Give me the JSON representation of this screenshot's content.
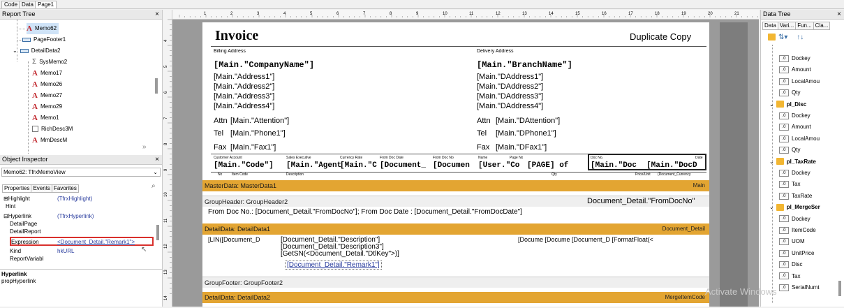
{
  "top_tabs": [
    "Code",
    "Data",
    "Page1"
  ],
  "report_tree": {
    "title": "Report Tree",
    "items": [
      "Memo62",
      "PageFooter1",
      "DetailData2",
      "SysMemo2",
      "Memo17",
      "Memo26",
      "Memo27",
      "Memo29",
      "Memo1",
      "RichDesc3M",
      "MmDescM"
    ]
  },
  "object_inspector": {
    "title": "Object Inspector",
    "selected": "Memo62: TfrxMemoView",
    "tabs": [
      "Properties",
      "Events",
      "Favorites"
    ],
    "props": [
      {
        "name": "Highlight",
        "value": "(TfrxHighlight)",
        "prefix": "⊞"
      },
      {
        "name": "Hint",
        "value": "",
        "prefix": ""
      },
      {
        "name": "Hyperlink",
        "value": "(TfrxHyperlink)",
        "prefix": "⊟"
      },
      {
        "name": "DetailPage",
        "value": "",
        "prefix": ""
      },
      {
        "name": "DetailReport",
        "value": "",
        "prefix": ""
      },
      {
        "name": "Expression",
        "value": "<Document_Detail.\"Remark1\">",
        "prefix": ""
      },
      {
        "name": "Kind",
        "value": "hkURL",
        "prefix": ""
      },
      {
        "name": "ReportVariabl",
        "value": "",
        "prefix": ""
      }
    ],
    "hint_title": "Hyperlink",
    "hint_text": "propHyperlink"
  },
  "ruler_numbers": [
    "1",
    "2",
    "3",
    "4",
    "5",
    "6",
    "7",
    "8",
    "9",
    "10",
    "11",
    "12",
    "13",
    "14",
    "15",
    "16",
    "17",
    "18",
    "19",
    "20",
    "21",
    "22"
  ],
  "ruler_v_numbers": [
    "4",
    "5",
    "6",
    "7",
    "8",
    "9",
    "10",
    "11",
    "12",
    "13",
    "14"
  ],
  "report": {
    "invoice_title": "Invoice",
    "duplicate": "Duplicate Copy",
    "billing_label": "Billing Address",
    "delivery_label": "Delivery Address",
    "company": "[Main.\"CompanyName\"]",
    "branch": "[Main.\"BranchName\"]",
    "addr": [
      "[Main.\"Address1\"]",
      "[Main.\"Address2\"]",
      "[Main.\"Address3\"]",
      "[Main.\"Address4\"]"
    ],
    "daddr": [
      "[Main.\"DAddress1\"]",
      "[Main.\"DAddress2\"]",
      "[Main.\"DAddress3\"]",
      "[Main.\"DAddress4\"]"
    ],
    "attn_l": "Attn",
    "attn_v": "[Main.\"Attention\"]",
    "tel_l": "Tel",
    "tel_v": "[Main.\"Phone1\"]",
    "fax_l": "Fax",
    "fax_v": "[Main.\"Fax1\"]",
    "dattn_v": "[Main.\"DAttention\"]",
    "dtel_v": "[Main.\"DPhone1\"]",
    "dfax_v": "[Main.\"DFax1\"]",
    "hdr_labels": [
      "Customer Account",
      "Sales Executive",
      "Currency Rate",
      "From Doc Date",
      "From Doc No",
      "Name",
      "Page No",
      "Doc No.",
      "Date"
    ],
    "hdr_values": [
      "[Main.\"Code\"]",
      "[Main.\"Agent",
      "[Main.\"C",
      "[Document_",
      "[Documen",
      "[User.\"Co",
      "[PAGE] of",
      "[Main.\"Doc",
      "[Main.\"DocD"
    ],
    "col_labels": [
      "No",
      "Item Code",
      "Description",
      "Qty",
      "Price/Unit",
      "(Document_Currency"
    ],
    "master_band": "MasterData: MasterData1",
    "master_link": "Main",
    "group_band": "GroupHeader: GroupHeader2",
    "group_right": "Document_Detail.\"FromDocNo\"",
    "from_doc_line": "From Doc No.: [Document_Detail.\"FromDocNo\"];    From Doc Date : [Document_Detail.\"FromDocDate\"]",
    "detail_band": "DetailData: DetailData1",
    "detail_link": "Document_Detail",
    "detail_left": "[LIN([Document_D",
    "detail_desc1": "[Document_Detail.\"Description\"]",
    "detail_desc3": "[Document_Detail.\"Description3\"]",
    "detail_getsn": "[GetSN(<Document_Detail.\"DtlKey\">)]",
    "detail_remark": "[Document_Detail.\"Remark1\"]",
    "detail_right": "[Docume [Docume [Document_D [FormatFloat(<",
    "footer_band": "GroupFooter: GroupFooter2",
    "detail2_band": "DetailData: DetailData2",
    "detail2_link": "MergeItemCode"
  },
  "data_tree": {
    "title": "Data Tree",
    "tabs": [
      "Data",
      "Vari...",
      "Fun...",
      "Cla..."
    ],
    "items": [
      {
        "label": "Dockey",
        "type": "field"
      },
      {
        "label": "Amount",
        "type": "field"
      },
      {
        "label": "LocalAmou",
        "type": "field"
      },
      {
        "label": "Qty",
        "type": "field"
      },
      {
        "label": "pl_Disc",
        "type": "db"
      },
      {
        "label": "Dockey",
        "type": "field"
      },
      {
        "label": "Amount",
        "type": "field"
      },
      {
        "label": "LocalAmou",
        "type": "field"
      },
      {
        "label": "Qty",
        "type": "field"
      },
      {
        "label": "pl_TaxRate",
        "type": "db"
      },
      {
        "label": "Dockey",
        "type": "field"
      },
      {
        "label": "Tax",
        "type": "field"
      },
      {
        "label": "TaxRate",
        "type": "field"
      },
      {
        "label": "pl_MergeSer",
        "type": "db"
      },
      {
        "label": "Dockey",
        "type": "field"
      },
      {
        "label": "ItemCode",
        "type": "field"
      },
      {
        "label": "UOM",
        "type": "field"
      },
      {
        "label": "UnitPrice",
        "type": "field"
      },
      {
        "label": "Disc",
        "type": "field"
      },
      {
        "label": "Tax",
        "type": "field"
      },
      {
        "label": "SerialNumt",
        "type": "field"
      }
    ]
  },
  "watermark": "Activate Windows",
  "colors": {
    "band_yellow": "#e3a532",
    "selected_border": "#d9302c",
    "link_blue": "#2a3d9e"
  }
}
